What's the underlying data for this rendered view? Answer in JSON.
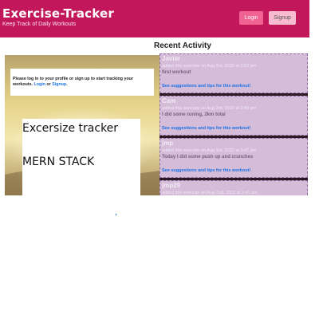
{
  "header": {
    "title": "Exercise-Tracker",
    "subtitle": "Keep Track of Daily Workouts",
    "login_label": "Login",
    "signup_label": "Signup",
    "brand_color": "#c2185b"
  },
  "notice": {
    "text_before": "Please log in to your profile or sign up to start tracking your workouts.",
    "login_link": "Login",
    "or_text": "or",
    "signup_link": "Signup",
    "end_text": "."
  },
  "hero": {
    "line1": "Excersize tracker",
    "line2": "MERN STACK"
  },
  "recent": {
    "title": "Recent Activity",
    "items": [
      {
        "user": "Javier",
        "date": "added this exercise on Aug 3rd, 2022 at 3:52 pm",
        "text": "first workout",
        "link": "See suggestions and tips for this workout!"
      },
      {
        "user": "Cam",
        "date": "added this exercise on Aug 3rd, 2022 at 3:49 pm",
        "text": "I did some runing, 2km total",
        "link": "See suggestions and tips for this workout!"
      },
      {
        "user": "jmp",
        "date": "added this exercise on Aug 3rd, 2022 at 3:47 pm",
        "text": "Today I did some push up and crunches",
        "link": "See suggestions and tips for this workout!"
      },
      {
        "user": "jmp29",
        "date": "added this exercise on Aug 2nd, 2022 at 1:41 am",
        "text": "",
        "link": ""
      }
    ]
  }
}
